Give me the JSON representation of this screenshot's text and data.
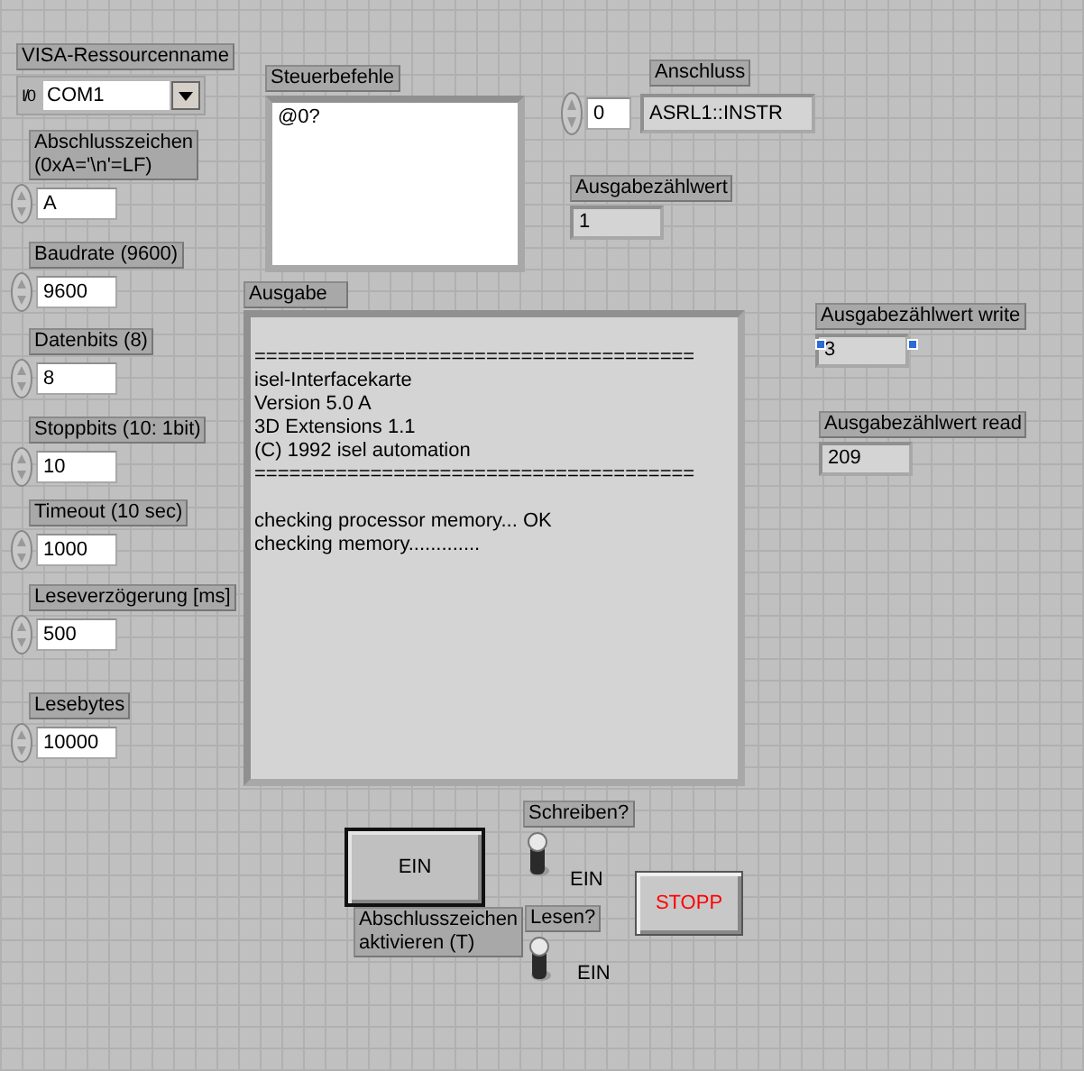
{
  "visa_resource": {
    "label": "VISA-Ressourcenname",
    "io_mark": "I/0",
    "value": "COM1"
  },
  "numeric_controls": [
    {
      "label": "Abschlusszeichen\n(0xA='\\n'=LF)",
      "value": "A"
    },
    {
      "label": "Baudrate (9600)",
      "value": "9600"
    },
    {
      "label": "Datenbits (8)",
      "value": "8"
    },
    {
      "label": "Stoppbits (10: 1bit)",
      "value": "10"
    },
    {
      "label": "Timeout (10 sec)",
      "value": "1000"
    },
    {
      "label": "Leseverzögerung [ms]",
      "value": "500"
    },
    {
      "label": "Lesebytes",
      "value": "10000"
    }
  ],
  "command_box": {
    "label": "Steuerbefehle",
    "value": "@0?"
  },
  "port": {
    "label": "Anschluss",
    "number": "0",
    "value": "ASRL1::INSTR"
  },
  "indicators": [
    {
      "label": "Ausgabezählwert",
      "value": "1",
      "selection_handles": false
    },
    {
      "label": "Ausgabezählwert write",
      "value": "3",
      "selection_handles": true
    },
    {
      "label": "Ausgabezählwert read",
      "value": "209",
      "selection_handles": false
    }
  ],
  "output": {
    "label": "Ausgabe",
    "text": "\n======================================\nisel-Interfacekarte\nVersion 5.0 A\n3D Extensions 1.1\n(C) 1992 isel automation\n======================================\n\nchecking processor memory... OK\nchecking memory............."
  },
  "terminator_button": {
    "text": "EIN",
    "label": "Abschlusszeichen\naktivieren (T)",
    "pressed": false
  },
  "switches": [
    {
      "label": "Schreiben?",
      "on": true,
      "state_text": "EIN"
    },
    {
      "label": "Lesen?",
      "on": true,
      "state_text": "EIN"
    }
  ],
  "stop_button": {
    "text": "STOPP"
  }
}
